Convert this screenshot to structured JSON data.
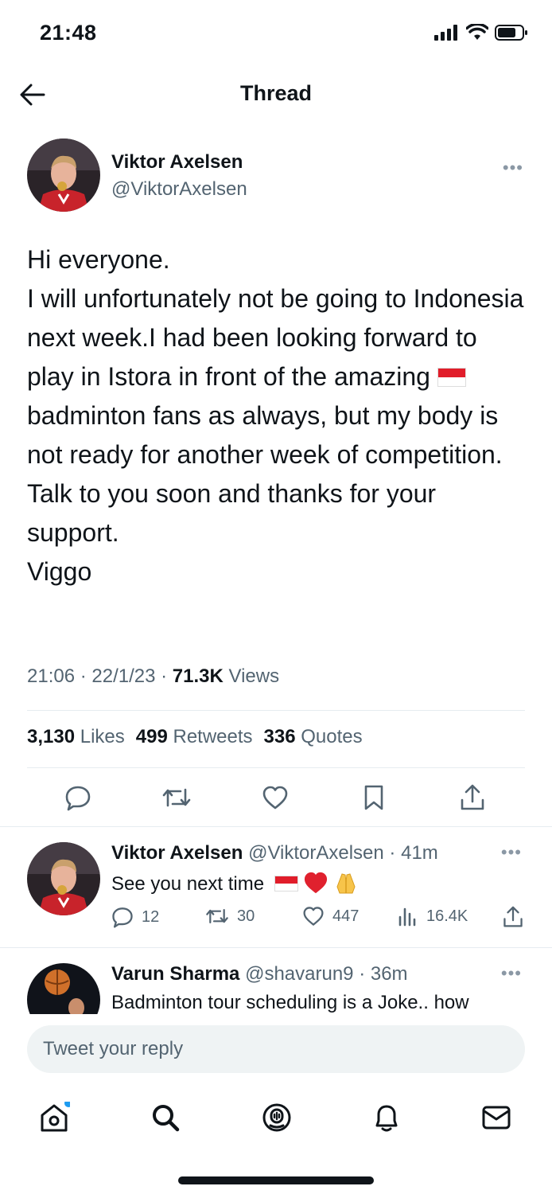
{
  "status_bar": {
    "time": "21:48"
  },
  "header": {
    "title": "Thread"
  },
  "main_tweet": {
    "author_name": "Viktor Axelsen",
    "author_handle": "@ViktorAxelsen",
    "text_line1": "Hi everyone.",
    "text_line2": "I will unfortunately not be going to Indonesia next week.I had been looking forward to play in Istora in front of the amazing",
    "text_line3": "badminton fans as always, but my body is not ready for another week of competition. Talk to you soon and thanks for your support.",
    "text_line4": "Viggo",
    "time": "21:06",
    "date": "22/1/23",
    "views_count": "71.3K",
    "views_label": "Views",
    "likes_count": "3,130",
    "likes_label": "Likes",
    "retweets_count": "499",
    "retweets_label": "Retweets",
    "quotes_count": "336",
    "quotes_label": "Quotes"
  },
  "replies": [
    {
      "name": "Viktor Axelsen",
      "handle": "@ViktorAxelsen",
      "age": "41m",
      "text": "See you next time",
      "reply_count": "12",
      "retweet_count": "30",
      "like_count": "447",
      "view_count": "16.4K"
    },
    {
      "name": "Varun Sharma",
      "handle": "@shavarun9",
      "age": "36m",
      "text": "Badminton tour scheduling is a Joke.. how"
    }
  ],
  "composer": {
    "placeholder": "Tweet your reply"
  },
  "colors": {
    "text": "#0f1419",
    "secondary": "#536471",
    "accent": "#1d9bf0",
    "divider": "#e6ecf0"
  },
  "icons": [
    "back-arrow-icon",
    "more-icon",
    "reply-icon",
    "retweet-icon",
    "like-icon",
    "bookmark-icon",
    "share-icon",
    "views-icon",
    "home-icon",
    "search-icon",
    "spaces-icon",
    "notifications-icon",
    "messages-icon"
  ]
}
